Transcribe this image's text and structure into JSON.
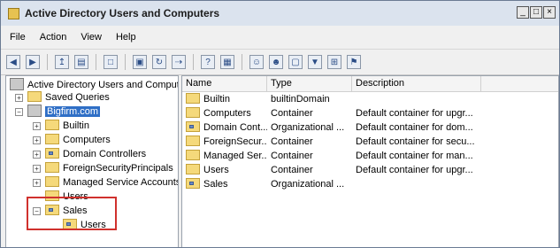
{
  "window": {
    "title": "Active Directory Users and Computers",
    "controls": [
      "_",
      "□",
      "×"
    ]
  },
  "menu": [
    "File",
    "Action",
    "View",
    "Help"
  ],
  "toolbar": {
    "buttons": [
      "back",
      "forward",
      "up",
      "show-console-tree",
      "properties",
      "export",
      "help",
      "new-user",
      "new-group",
      "new-ou",
      "filter",
      "add-to-group",
      "delegate"
    ]
  },
  "tree": {
    "root": "Active Directory Users and Comput",
    "saved_queries": "Saved Queries",
    "domain": "Bigfirm.com",
    "children": [
      "Builtin",
      "Computers",
      "Domain Controllers",
      "ForeignSecurityPrincipals",
      "Managed Service Accounts",
      "Users",
      "Sales"
    ],
    "sales_child": "Users"
  },
  "list": {
    "columns": [
      "Name",
      "Type",
      "Description"
    ],
    "rows": [
      {
        "name": "Builtin",
        "type": "builtinDomain",
        "description": ""
      },
      {
        "name": "Computers",
        "type": "Container",
        "description": "Default container for upgr..."
      },
      {
        "name": "Domain Cont...",
        "type": "Organizational ...",
        "description": "Default container for dom..."
      },
      {
        "name": "ForeignSecur...",
        "type": "Container",
        "description": "Default container for secu..."
      },
      {
        "name": "Managed Ser...",
        "type": "Container",
        "description": "Default container for man..."
      },
      {
        "name": "Users",
        "type": "Container",
        "description": "Default container for upgr..."
      },
      {
        "name": "Sales",
        "type": "Organizational ...",
        "description": ""
      }
    ]
  }
}
